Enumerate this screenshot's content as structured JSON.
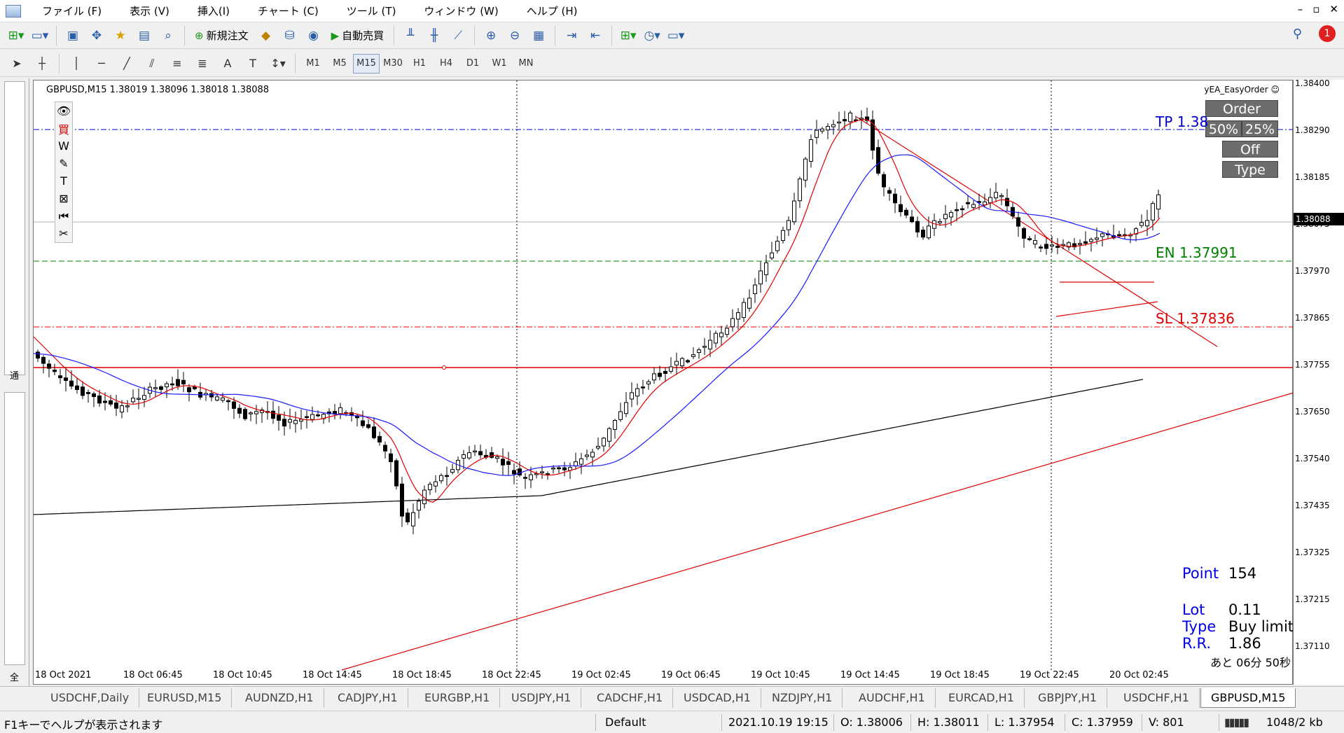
{
  "menu": [
    "ファイル (F)",
    "表示 (V)",
    "挿入(I)",
    "チャート (C)",
    "ツール (T)",
    "ウィンドウ (W)",
    "ヘルプ (H)"
  ],
  "toolbar": {
    "new_order": "新規注文",
    "auto_trade": "自動売買",
    "notification_count": "1"
  },
  "timeframes": [
    "M1",
    "M5",
    "M15",
    "M30",
    "H1",
    "H4",
    "D1",
    "W1",
    "MN"
  ],
  "active_timeframe": "M15",
  "left_panel": {
    "tab1": "通",
    "tab2": "全"
  },
  "chart": {
    "symbol_info": "GBPUSD,M15  1.38019 1.38096 1.38018 1.38088",
    "ea_name": "yEA_EasyOrder ☺",
    "buttons": {
      "order": "Order",
      "p50": "50%",
      "p25": "25%",
      "off": "Off",
      "type": "Type"
    },
    "tp_label": "TP  1.38",
    "en_label": "EN  1.37991",
    "sl_label": "SL  1.37836",
    "point_label": "Point",
    "point_value": "154",
    "lot_label": "Lot",
    "lot_value": "0.11",
    "type_label": "Type",
    "type_value": "Buy limit",
    "rr_label": "R.R.",
    "rr_value": "1.86",
    "time_left": "あと 06分 50秒",
    "colors": {
      "tp": "#0000cc",
      "en": "#008000",
      "sl": "#e00000",
      "ma_red": "#e00000",
      "ma_blue": "#1a1aff",
      "ma_black": "#000000"
    }
  },
  "price_axis": [
    "1.38400",
    "1.38290",
    "1.38185",
    "1.38075",
    "1.37970",
    "1.37865",
    "1.37755",
    "1.37650",
    "1.37540",
    "1.37435",
    "1.37325",
    "1.37215",
    "1.37110"
  ],
  "current_price": "1.38088",
  "time_axis": [
    "18 Oct 2021",
    "18 Oct 06:45",
    "18 Oct 10:45",
    "18 Oct 14:45",
    "18 Oct 18:45",
    "18 Oct 22:45",
    "19 Oct 02:45",
    "19 Oct 06:45",
    "19 Oct 10:45",
    "19 Oct 14:45",
    "19 Oct 18:45",
    "19 Oct 22:45",
    "20 Oct 02:45"
  ],
  "tabs": [
    "USDCHF,Daily",
    "EURUSD,M15",
    "AUDNZD,H1",
    "CADJPY,H1",
    "EURGBP,H1",
    "USDJPY,H1",
    "CADCHF,H1",
    "USDCAD,H1",
    "NZDJPY,H1",
    "AUDCHF,H1",
    "EURCAD,H1",
    "GBPJPY,H1",
    "USDCHF,H1",
    "GBPUSD,M15"
  ],
  "status": {
    "help": "F1キーでヘルプが表示されます",
    "profile": "Default",
    "datetime": "2021.10.19 19:15",
    "open": "O: 1.38006",
    "high": "H: 1.38011",
    "low": "L: 1.37954",
    "close": "C: 1.37959",
    "volume": "V: 801",
    "traffic": "1048/2 kb"
  }
}
